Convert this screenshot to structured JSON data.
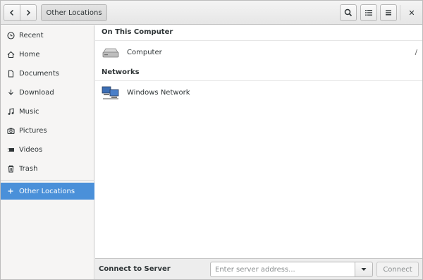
{
  "header": {
    "path_label": "Other Locations",
    "close_glyph": "✕"
  },
  "sidebar": {
    "items": [
      {
        "label": "Recent",
        "icon": "clock-icon"
      },
      {
        "label": "Home",
        "icon": "home-icon"
      },
      {
        "label": "Documents",
        "icon": "document-icon"
      },
      {
        "label": "Download",
        "icon": "download-icon"
      },
      {
        "label": "Music",
        "icon": "music-icon"
      },
      {
        "label": "Pictures",
        "icon": "camera-icon"
      },
      {
        "label": "Videos",
        "icon": "video-icon"
      },
      {
        "label": "Trash",
        "icon": "trash-icon"
      },
      {
        "label": "Other Locations",
        "icon": "plus-icon",
        "active": true
      }
    ]
  },
  "main": {
    "on_this_computer_title": "On This Computer",
    "computer": {
      "label": "Computer",
      "path": "/",
      "icon": "drive-icon"
    },
    "networks_title": "Networks",
    "windows_network": {
      "label": "Windows Network",
      "icon": "network-icon"
    }
  },
  "bottom": {
    "connect_label": "Connect to Server",
    "server_placeholder": "Enter server address...",
    "connect_button": "Connect"
  },
  "colors": {
    "accent": "#4a90d9"
  }
}
